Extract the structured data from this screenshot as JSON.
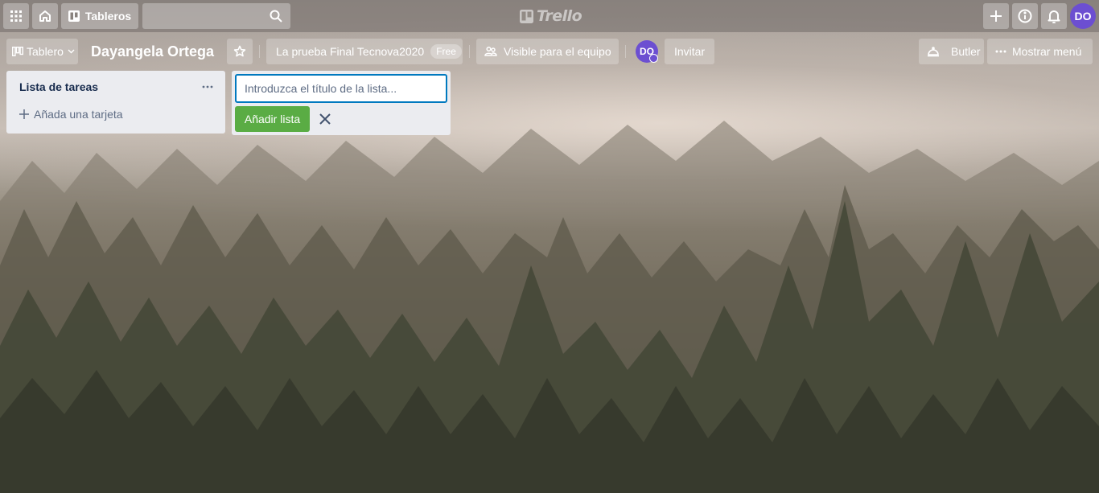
{
  "topnav": {
    "apps_icon": "grid-icon",
    "home_icon": "home-icon",
    "boards_label": "Tableros",
    "search_placeholder": "",
    "logo_text": "Trello",
    "create_icon": "plus-icon",
    "info_icon": "info-icon",
    "notifications_icon": "bell-icon",
    "user_initials": "DO"
  },
  "board_header": {
    "view_switcher_label": "Tablero",
    "board_name": "Dayangela Ortega",
    "team_name": "La prueba Final Tecnova2020",
    "team_badge": "Free",
    "visibility_label": "Visible para el equipo",
    "member_initials": "DO",
    "invite_label": "Invitar",
    "butler_label": "Butler",
    "menu_label": "Mostrar menú"
  },
  "lists": [
    {
      "title": "Lista de tareas",
      "add_card_label": "Añada una tarjeta"
    }
  ],
  "add_list": {
    "placeholder": "Introduzca el título de la lista...",
    "add_button_label": "Añadir lista"
  },
  "colors": {
    "accent_blue": "#0079bf",
    "add_green": "#5aac44",
    "avatar_purple": "#6c4fd1",
    "list_bg": "#ebecf0"
  }
}
